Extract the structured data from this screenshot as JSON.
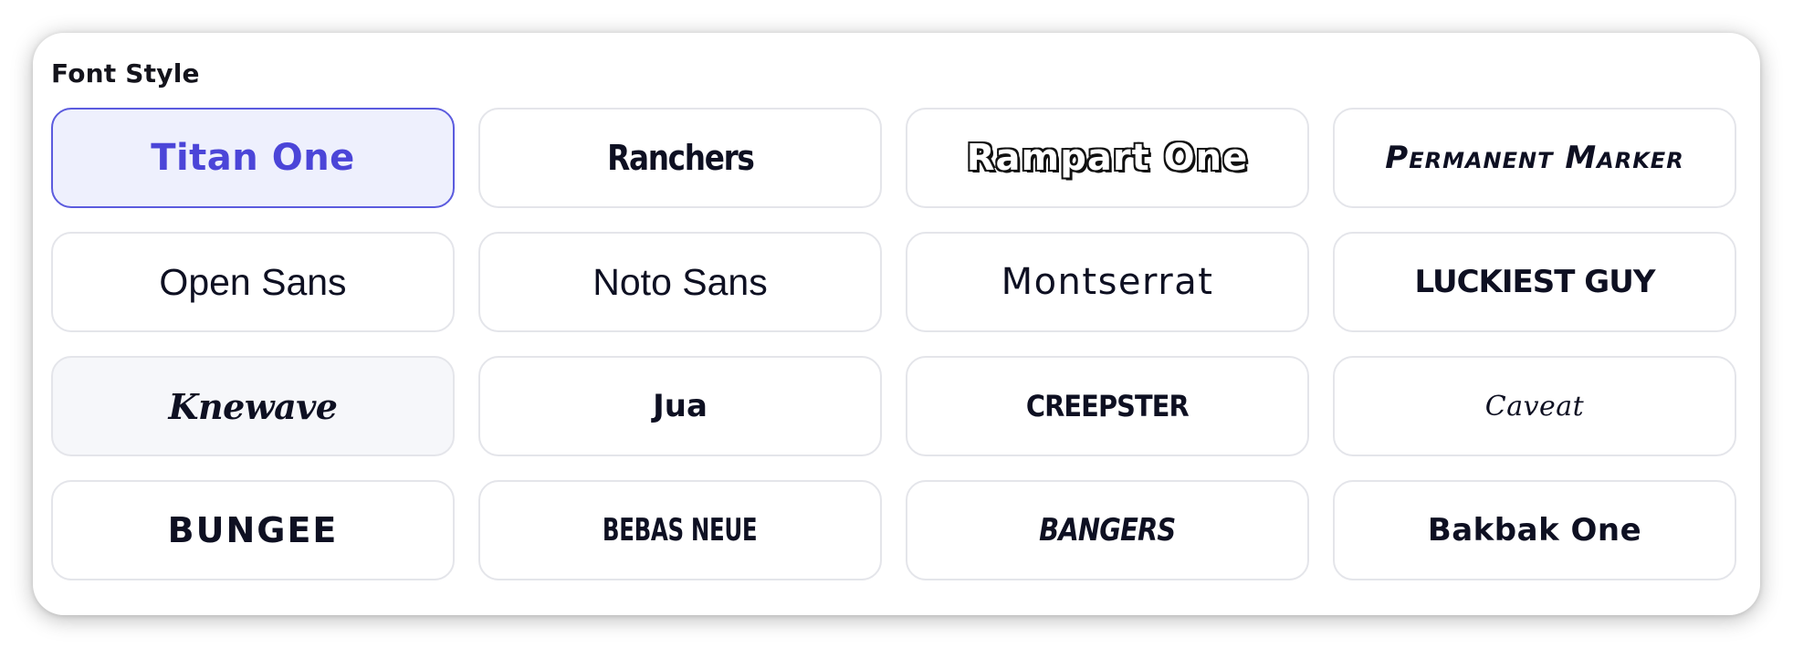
{
  "panel": {
    "title": "Font Style"
  },
  "font_options": [
    {
      "label": "Titan One",
      "state": "selected"
    },
    {
      "label": "Ranchers",
      "state": "default"
    },
    {
      "label": "Rampart One",
      "state": "default"
    },
    {
      "label": "Permanent Marker",
      "state": "default"
    },
    {
      "label": "Open Sans",
      "state": "default"
    },
    {
      "label": "Noto Sans",
      "state": "default"
    },
    {
      "label": "Montserrat",
      "state": "default"
    },
    {
      "label": "Luckiest Guy",
      "state": "default"
    },
    {
      "label": "Knewave",
      "state": "hover"
    },
    {
      "label": "Jua",
      "state": "default"
    },
    {
      "label": "Creepster",
      "state": "default"
    },
    {
      "label": "Caveat",
      "state": "default"
    },
    {
      "label": "Bungee",
      "state": "default"
    },
    {
      "label": "Bebas Neue",
      "state": "default"
    },
    {
      "label": "Bangers",
      "state": "default"
    },
    {
      "label": "Bakbak One",
      "state": "default"
    }
  ],
  "colors": {
    "accent": "#5b5bde",
    "selected_background": "#eef0fd",
    "selected_text": "#4b45d8",
    "border": "#e4e5ea",
    "text": "#0e1022"
  }
}
